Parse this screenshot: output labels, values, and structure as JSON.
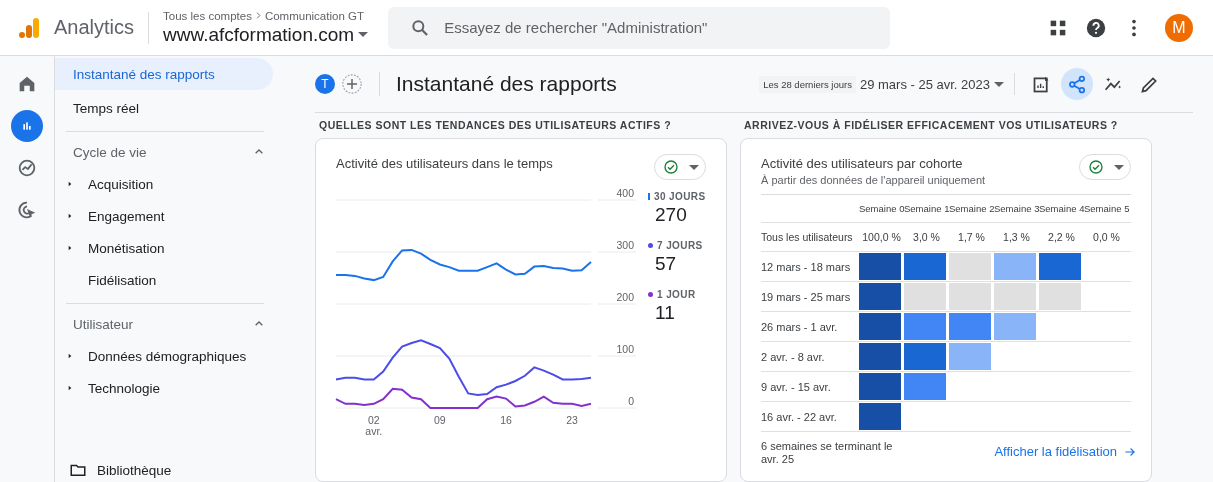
{
  "topbar": {
    "product": "Analytics",
    "breadcrumb": [
      "Tous les comptes",
      "Communication GT"
    ],
    "property": "www.afcformation.com",
    "search": {
      "placeholder": "Essayez de rechercher \"Administration\""
    },
    "avatar": "M"
  },
  "rail": [
    {
      "kind": "home",
      "selected": false
    },
    {
      "kind": "reports",
      "selected": true
    },
    {
      "kind": "explore",
      "selected": false
    },
    {
      "kind": "advertising",
      "selected": false
    }
  ],
  "sidebar": {
    "links": [
      {
        "label": "Instantané des rapports",
        "selected": true
      },
      {
        "label": "Temps réel",
        "selected": false
      }
    ],
    "sections": [
      {
        "title": "Cycle de vie",
        "expanded": true,
        "items": [
          {
            "label": "Acquisition",
            "expandable": true,
            "selected": false
          },
          {
            "label": "Engagement",
            "expandable": true,
            "selected": false
          },
          {
            "label": "Monétisation",
            "expandable": true,
            "selected": false
          },
          {
            "label": "Fidélisation",
            "expandable": false,
            "selected": false
          }
        ]
      },
      {
        "title": "Utilisateur",
        "expanded": true,
        "items": [
          {
            "label": "Données démographiques",
            "expandable": true,
            "selected": false
          },
          {
            "label": "Technologie",
            "expandable": true,
            "selected": false
          }
        ]
      }
    ],
    "library": "Bibliothèque"
  },
  "header": {
    "avatar": "T",
    "title": "Instantané des rapports",
    "range_label": "Les 28 derniers jours",
    "date_range": "29 mars - 25 avr. 2023",
    "tools": [
      {
        "kind": "customize",
        "selected": false
      },
      {
        "kind": "share",
        "selected": true
      },
      {
        "kind": "insights",
        "selected": false
      },
      {
        "kind": "edit",
        "selected": false
      }
    ]
  },
  "activity": {
    "heading": "QUELLES SONT LES TENDANCES DES UTILISATEURS ACTIFS ?",
    "title": "Activité des utilisateurs dans le temps",
    "legend_values": [
      "270",
      "57",
      "11"
    ],
    "chart_data": {
      "type": "line",
      "categories": [
        null,
        null,
        null,
        null,
        "02 avr.",
        null,
        null,
        null,
        null,
        null,
        null,
        "09",
        null,
        null,
        null,
        null,
        null,
        null,
        "16",
        null,
        null,
        null,
        null,
        null,
        null,
        "23",
        null,
        null
      ],
      "ylim": [
        0,
        400
      ],
      "grid": true,
      "yticks": [
        0,
        100,
        200,
        300,
        400
      ],
      "series": [
        {
          "name": "30 JOURS",
          "color": "#1a73e8",
          "values": [
            256,
            256,
            254,
            249,
            246,
            252,
            282,
            303,
            304,
            297,
            285,
            276,
            271,
            264,
            264,
            264,
            271,
            278,
            266,
            257,
            258,
            272,
            273,
            269,
            268,
            264,
            265,
            281
          ]
        },
        {
          "name": "7 JOURS",
          "color": "#4c4ce8",
          "values": [
            55,
            58,
            58,
            55,
            55,
            70,
            97,
            118,
            125,
            130,
            123,
            115,
            95,
            60,
            28,
            25,
            27,
            40,
            45,
            52,
            62,
            78,
            72,
            64,
            55,
            55,
            56,
            58
          ]
        },
        {
          "name": "1 JOUR",
          "color": "#8430ce",
          "values": [
            17,
            8,
            8,
            6,
            8,
            17,
            37,
            35,
            20,
            17,
            0,
            0,
            0,
            0,
            0,
            0,
            17,
            22,
            18,
            3,
            5,
            12,
            22,
            10,
            8,
            8,
            4,
            8
          ]
        }
      ]
    }
  },
  "cohort": {
    "heading": "ARRIVEZ-VOUS À FIDÉLISER EFFICACEMENT VOS UTILISATEURS ?",
    "title": "Activité des utilisateurs par cohorte",
    "subtitle": "À partir des données de l'appareil uniquement",
    "columns": [
      "Semaine 0",
      "Semaine 1",
      "Semaine 2",
      "Semaine 3",
      "Semaine 4",
      "Semaine 5"
    ],
    "total": {
      "label": "Tous les utilisateurs",
      "values": [
        "100,0 %",
        "3,0 %",
        "1,7 %",
        "1,3 %",
        "2,2 %",
        "0,0 %"
      ]
    },
    "rows": [
      {
        "label": "12 mars - 18 mars",
        "cells": [
          {
            "color": "#174ea6"
          },
          {
            "color": "#1967d2"
          },
          {
            "color": "#e0e0e0"
          },
          {
            "color": "#8ab4f8"
          },
          {
            "color": "#1967d2"
          }
        ]
      },
      {
        "label": "19 mars - 25 mars",
        "cells": [
          {
            "color": "#174ea6"
          },
          {
            "color": "#e0e0e0"
          },
          {
            "color": "#e0e0e0"
          },
          {
            "color": "#e0e0e0"
          },
          {
            "color": "#e0e0e0"
          }
        ]
      },
      {
        "label": "26 mars - 1 avr.",
        "cells": [
          {
            "color": "#174ea6"
          },
          {
            "color": "#4285f4"
          },
          {
            "color": "#4285f4"
          },
          {
            "color": "#8ab4f8"
          }
        ]
      },
      {
        "label": "2 avr. - 8 avr.",
        "cells": [
          {
            "color": "#174ea6"
          },
          {
            "color": "#1967d2"
          },
          {
            "color": "#8ab4f8"
          }
        ]
      },
      {
        "label": "9 avr. - 15 avr.",
        "cells": [
          {
            "color": "#174ea6"
          },
          {
            "color": "#4285f4"
          }
        ]
      },
      {
        "label": "16 avr. - 22 avr.",
        "cells": [
          {
            "color": "#174ea6"
          }
        ]
      }
    ],
    "footnote": "6 semaines se terminant le avr. 25",
    "link": "Afficher la fidélisation"
  }
}
